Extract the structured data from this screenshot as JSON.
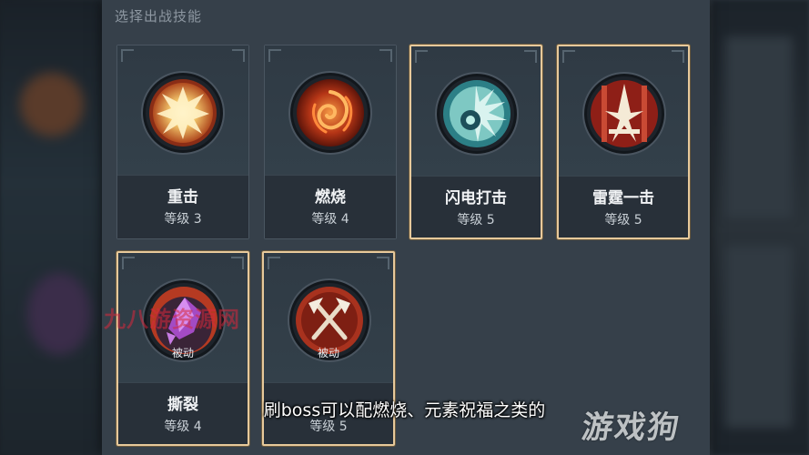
{
  "panel": {
    "title": "选择出战技能"
  },
  "skills": [
    {
      "name": "重击",
      "level": "等级 3",
      "icon": "heavy-strike-icon"
    },
    {
      "name": "燃烧",
      "level": "等级 4",
      "icon": "burn-icon"
    },
    {
      "name": "闪电打击",
      "level": "等级 5",
      "icon": "lightning-strike-icon"
    },
    {
      "name": "雷霆一击",
      "level": "等级 5",
      "icon": "thunder-strike-icon"
    },
    {
      "name": "撕裂",
      "level": "等级 4",
      "icon": "tear-icon",
      "tag": "被动"
    },
    {
      "name": "",
      "level": "等级 5",
      "icon": "crossed-axes-icon",
      "tag": "被动"
    }
  ],
  "overlay": {
    "watermark": "九八游资源网",
    "subtitle": "刷boss可以配燃烧、元素祝福之类的",
    "logo": "游戏狗"
  },
  "colors": {
    "selected_border": "#e7c99b",
    "panel_bg": "#36404a",
    "card_bg": "#2c3640"
  }
}
